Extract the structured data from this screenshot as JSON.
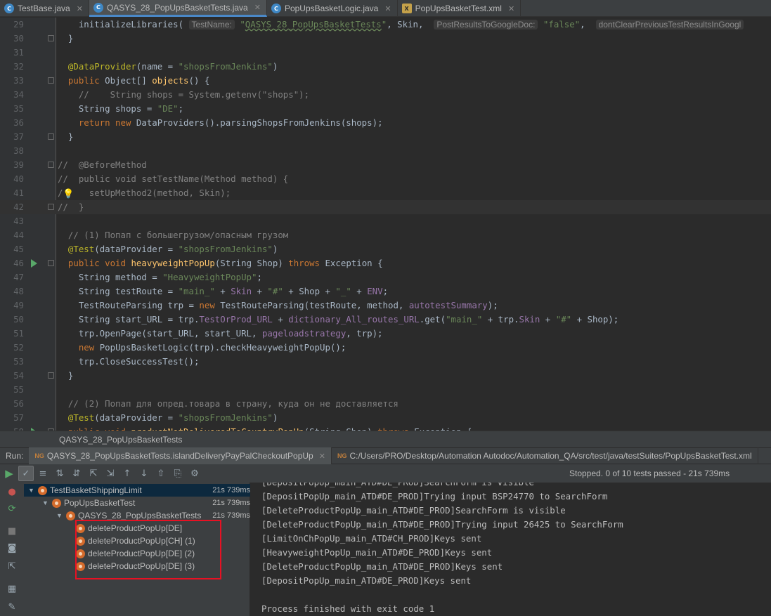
{
  "tabs": [
    {
      "label": "TestBase.java",
      "icon": "java-class-icon",
      "badge": "C"
    },
    {
      "label": "QASYS_28_PopUpsBasketTests.java",
      "icon": "java-class-icon",
      "badge": "C",
      "active": true
    },
    {
      "label": "PopUpsBasketLogic.java",
      "icon": "java-class-icon",
      "badge": "C"
    },
    {
      "label": "PopUpsBasketTest.xml",
      "icon": "xml-file-icon",
      "badge": "X"
    }
  ],
  "editor": {
    "lines": [
      {
        "n": "29",
        "html": "<span class=\"kw\"></span>    initializeLibraries( <span class=\"hint\">TestName:</span> <span class=\"str\">\"<span class=\"wavy\">QASYS_28_PopUpsBasketTests</span>\"</span>, Skin,  <span class=\"hint\">PostResultsToGoogleDoc:</span> <span class=\"str\">\"false\"</span>,  <span class=\"hint\">dontClearPreviousTestResultsInGoogl</span>"
      },
      {
        "n": "30",
        "html": "  }"
      },
      {
        "n": "31",
        "html": ""
      },
      {
        "n": "32",
        "html": "  <span class=\"ann\">@DataProvider</span>(name = <span class=\"str\">\"shopsFromJenkins\"</span>)"
      },
      {
        "n": "33",
        "html": "  <span class=\"kw\">public</span> Object[] <span class=\"fn\">objects</span>() {"
      },
      {
        "n": "34",
        "html": "    <span class=\"cmt\">//    String shops = System.getenv(\"shops\");</span>"
      },
      {
        "n": "35",
        "html": "    String shops = <span class=\"str\">\"DE\"</span>;"
      },
      {
        "n": "36",
        "html": "    <span class=\"kw\">return new</span> DataProviders().parsingShopsFromJenkins(shops);"
      },
      {
        "n": "37",
        "html": "  }"
      },
      {
        "n": "38",
        "html": ""
      },
      {
        "n": "39",
        "html": "<span class=\"cmt\">//  @BeforeMethod</span>"
      },
      {
        "n": "40",
        "html": "<span class=\"cmt\">//  public void setTestName(Method method) {</span>"
      },
      {
        "n": "41",
        "html": "<span class=\"cmt\">/     setUpMethod2(method, Skin);</span>"
      },
      {
        "n": "42",
        "html": "<span class=\"cmt\">//  }</span>"
      },
      {
        "n": "43",
        "html": ""
      },
      {
        "n": "44",
        "html": "  <span class=\"cmt\">// (1) Попап с большегрузом/опасным грузом</span>"
      },
      {
        "n": "45",
        "html": "  <span class=\"ann\">@Test</span>(dataProvider = <span class=\"str\">\"shopsFromJenkins\"</span>)"
      },
      {
        "n": "46",
        "html": "  <span class=\"kw\">public void</span> <span class=\"fn\">heavyweightPopUp</span>(String Shop) <span class=\"kw\">throws</span> Exception {"
      },
      {
        "n": "47",
        "html": "    String method = <span class=\"str\">\"HeavyweightPopUp\"</span>;"
      },
      {
        "n": "48",
        "html": "    String testRoute = <span class=\"str\">\"main_\"</span> + <span class=\"fld\">Skin</span> + <span class=\"str\">\"#\"</span> + Shop + <span class=\"str\">\"_\"</span> + <span class=\"fld\">ENV</span>;"
      },
      {
        "n": "49",
        "html": "    TestRouteParsing trp = <span class=\"kw\">new</span> TestRouteParsing(testRoute, method, <span class=\"fld\">autotestSummary</span>);"
      },
      {
        "n": "50",
        "html": "    String start_URL = trp.<span class=\"fld\">TestOrProd_URL</span> + <span class=\"fld\">dictionary_All_routes_URL</span>.get(<span class=\"str\">\"main_\"</span> + trp.<span class=\"fld\">Skin</span> + <span class=\"str\">\"#\"</span> + Shop);"
      },
      {
        "n": "51",
        "html": "    trp.OpenPage(start_URL, start_URL, <span class=\"fld\">pageloadstrategy</span>, trp);"
      },
      {
        "n": "52",
        "html": "    <span class=\"kw\">new</span> PopUpsBasketLogic(trp).checkHeavyweightPopUp();"
      },
      {
        "n": "53",
        "html": "    trp.CloseSuccessTest();"
      },
      {
        "n": "54",
        "html": "  }"
      },
      {
        "n": "55",
        "html": ""
      },
      {
        "n": "56",
        "html": "  <span class=\"cmt\">// (2) Попап для опред.товара в страну, куда он не доставляется</span>"
      },
      {
        "n": "57",
        "html": "  <span class=\"ann\">@Test</span>(dataProvider = <span class=\"str\">\"shopsFromJenkins\"</span>)"
      },
      {
        "n": "58",
        "html": "  <span class=\"kw\">public void</span> <span class=\"fn\">productNotDeliveredToCountryPopUp</span>(String Shop) <span class=\"kw\">throws</span> Exception {"
      }
    ]
  },
  "run": {
    "title": "QASYS_28_PopUpsBasketTests",
    "label": "Run:",
    "tabs": [
      {
        "label": "QASYS_28_PopUpsBasketTests.islandDeliveryPayPalCheckoutPopUp",
        "active": true
      },
      {
        "label": "C:/Users/PRO/Desktop/Automation Autodoc/Automation_QA/src/test/java/testSuites/PopUpsBasketTest.xml"
      }
    ],
    "status": "Stopped. 0 of 10 tests passed - 21s 739ms"
  },
  "tree": [
    {
      "label": "TestBasketShippingLimit",
      "time": "21s 739ms",
      "level": 0,
      "expanded": true,
      "selected": true
    },
    {
      "label": "PopUpsBasketTest",
      "time": "21s 739ms",
      "level": 1,
      "expanded": true
    },
    {
      "label": "QASYS_28_PopUpsBasketTests",
      "time": "21s 739ms",
      "level": 2,
      "expanded": true
    },
    {
      "label": "deleteProductPopUp[DE]",
      "time": "",
      "level": 3
    },
    {
      "label": "deleteProductPopUp[CH] (1)",
      "time": "",
      "level": 3
    },
    {
      "label": "deleteProductPopUp[DE] (2)",
      "time": "",
      "level": 3
    },
    {
      "label": "deleteProductPopUp[DE] (3)",
      "time": "",
      "level": 3
    }
  ],
  "console": [
    "[DepositPopUp_main_ATD#DE_PROD]SearchForm is visible",
    "[DepositPopUp_main_ATD#DE_PROD]Trying input BSP24770 to SearchForm",
    "[DeleteProductPopUp_main_ATD#DE_PROD]SearchForm is visible",
    "[DeleteProductPopUp_main_ATD#DE_PROD]Trying input 26425 to SearchForm",
    "[LimitOnChPopUp_main_ATD#CH_PROD]Keys sent",
    "[HeavyweightPopUp_main_ATD#DE_PROD]Keys sent",
    "[DeleteProductPopUp_main_ATD#DE_PROD]Keys sent",
    "[DepositPopUp_main_ATD#DE_PROD]Keys sent",
    "",
    "Process finished with exit code 1"
  ]
}
